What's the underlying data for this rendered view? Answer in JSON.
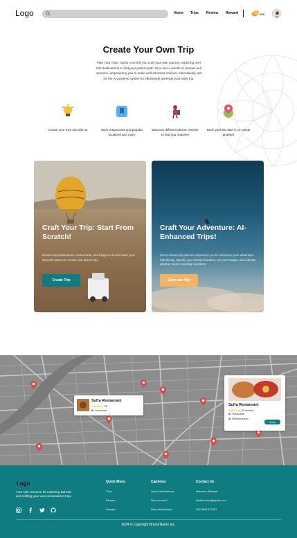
{
  "header": {
    "logo": "Logo",
    "nav": [
      "Home",
      "Trips",
      "Review",
      "Reward"
    ],
    "coins": "220"
  },
  "hero": {
    "title": "Create Your Own Trip",
    "intro": "Plan Your Trips: Option one lets you craft your own journey, exploring over 100 destinations to find your perfect path. Dive into a wealth of reviews and opinions, empowering you to make well-informed choices. Alternatively, opt for the AI-powered system to effortlessly generate your ideal trip."
  },
  "features": [
    {
      "icon": "lightbulb-icon",
      "text": "Create your own trip with us"
    },
    {
      "icon": "bookmark-icon",
      "text": "Save restaurants and popular locations and more"
    },
    {
      "icon": "traveler-icon",
      "text": "Discover different places reviews to find you matches"
    },
    {
      "icon": "map-pin-icon",
      "text": "Save your trip start it, or create another!"
    }
  ],
  "cards": [
    {
      "title": "Craft Your Trip: Start From Scratch!",
      "text": "Browse top destinations, restaurants, and things to do and save your favourite places to create your dream trip.",
      "button": "Create Trip"
    },
    {
      "title": "Craft Your Adventure: AI-Enhanced Trips!",
      "text": "Our AI-driven trip planner empowers you to customize your adventure effortlessly. Specify your desired duration, set your budget, and indicate whether you're traveling members.",
      "button": "Generate Trip"
    }
  ],
  "map": {
    "small_card": {
      "name": "Sufra Restaurant",
      "reviews": "20",
      "category": "Restaurant"
    },
    "large_card": {
      "name": "Sufra Restaurant",
      "reviews": "20 reviews",
      "category": "Restaurant",
      "cuisine": "Mediterranean",
      "button": "Show"
    }
  },
  "footer": {
    "logo": "Logo",
    "desc": "Your sole resource for exploring Bahrain and crafting your own personalized trips.",
    "quick_menu": {
      "title": "Quick Menu",
      "links": [
        "Trips",
        "Review",
        "Reward"
      ]
    },
    "captions": {
      "title": "Captions",
      "links": [
        "About clickVenture",
        "Who we are?",
        "Why clickVenture"
      ]
    },
    "contact": {
      "title": "Contact Us",
      "links": [
        "Manama, Bahrain",
        "clickVenture@gmail.com",
        "002-3861012321"
      ]
    },
    "copyright": "2024 © Copyright Brand-Name Inc."
  },
  "colors": {
    "accent": "#0e7c80",
    "gold": "#f1b463"
  }
}
